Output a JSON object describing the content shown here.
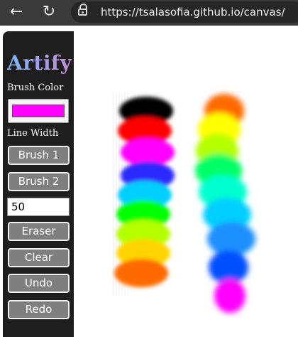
{
  "browser": {
    "url": "https://tsalasofia.github.io/canvas/",
    "back_icon": "←",
    "reload_icon": "↻"
  },
  "sidebar": {
    "title": "Artify",
    "brush_color_label": "Brush Color",
    "brush_color_value": "#ff00ff",
    "line_width_label": "Line Width",
    "line_width_value": "50",
    "buttons": {
      "brush1": "Brush 1",
      "brush2": "Brush 2",
      "eraser": "Eraser",
      "clear": "Clear",
      "undo": "Undo",
      "redo": "Redo"
    }
  },
  "canvas": {
    "left_stroke_colors": [
      "#000000",
      "#ff0000",
      "#ff00ff",
      "#2b2bff",
      "#00cfff",
      "#00ff00",
      "#b4ff00",
      "#ffd400",
      "#ff6a00"
    ],
    "right_stroke_colors": [
      "#ff6a00",
      "#ffff00",
      "#b4ff00",
      "#00ff66",
      "#00ffd0",
      "#00cfff",
      "#1e90ff",
      "#0050ff",
      "#ff00ff"
    ]
  }
}
